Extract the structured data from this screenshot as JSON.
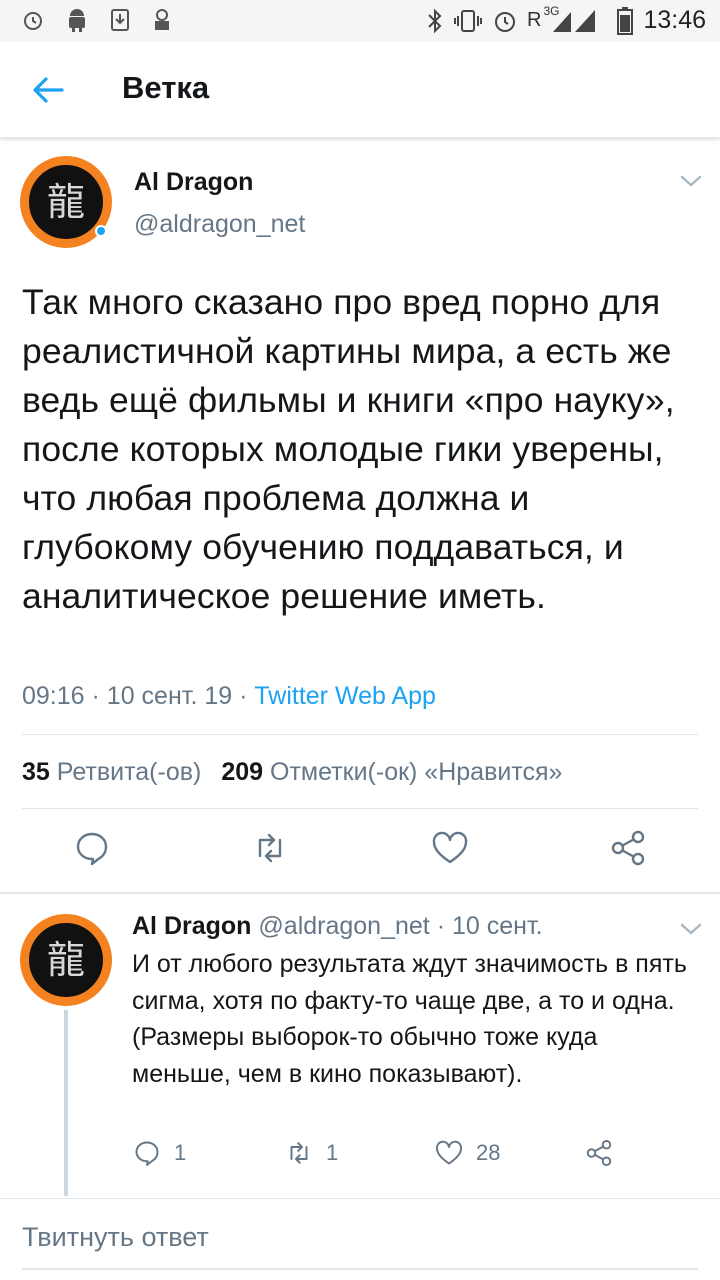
{
  "status_bar": {
    "time": "13:46",
    "network_label": "R",
    "network_type": "3G",
    "left_icons": [
      "alarm-clock-icon",
      "android-icon",
      "download-icon",
      "robot-icon"
    ],
    "right_icons": [
      "bluetooth-icon",
      "vibrate-icon",
      "alarm-icon",
      "signal-icon",
      "battery-icon"
    ]
  },
  "header": {
    "title": "Ветка"
  },
  "main_tweet": {
    "name": "Al Dragon",
    "handle": "@aldragon_net",
    "avatar_glyph": "龍",
    "text": "Так много сказано про вред порно для реалистичной картины мира, а есть же ведь ещё фильмы и книги «про науку», после которых молодые гики уверены, что любая проблема должна и глубокому обучению поддаваться, и аналитическое решение иметь.",
    "time": "09:16",
    "date": "10 сент. 19",
    "separator": "·",
    "source": "Twitter Web App",
    "retweets_count": "35",
    "retweets_label": "Ретвита(-ов)",
    "likes_count": "209",
    "likes_label": "Отметки(-ок) «Нравится»"
  },
  "reply": {
    "name": "Al Dragon",
    "handle": "@aldragon_net",
    "separator": "·",
    "date": "10 сент.",
    "avatar_glyph": "龍",
    "text": "И от любого результата ждут значимость в пять сигма, хотя по факту-то чаще две, а то и одна.\n(Размеры выборок-то обычно тоже куда меньше, чем в кино показывают).",
    "reply_count": "1",
    "retweet_count": "1",
    "like_count": "28"
  },
  "compose": {
    "placeholder": "Твитнуть ответ"
  },
  "colors": {
    "accent": "#1da1f2",
    "secondary_text": "#657786",
    "avatar_ring": "#f58220"
  }
}
